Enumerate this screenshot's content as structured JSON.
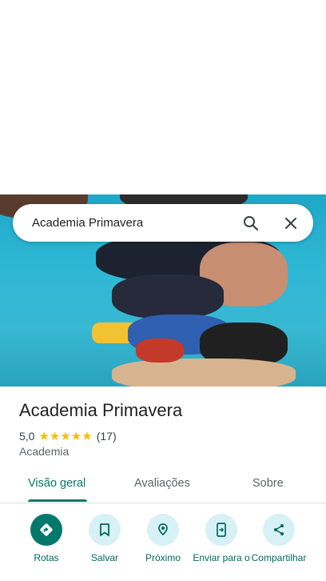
{
  "search": {
    "query": "Academia Primavera"
  },
  "place": {
    "name": "Academia Primavera",
    "rating": "5,0",
    "stars": "★★★★★",
    "review_count": "(17)",
    "category": "Academia"
  },
  "tabs": [
    {
      "label": "Visão geral",
      "active": true
    },
    {
      "label": "Avaliações",
      "active": false
    },
    {
      "label": "Sobre",
      "active": false
    }
  ],
  "actions": [
    {
      "label": "Rotas",
      "icon": "directions-icon"
    },
    {
      "label": "Salvar",
      "icon": "bookmark-icon"
    },
    {
      "label": "Próximo",
      "icon": "nearby-icon"
    },
    {
      "label": "Enviar para o",
      "icon": "send-to-phone-icon"
    },
    {
      "label": "Compartilhar",
      "icon": "share-icon"
    }
  ],
  "colors": {
    "accent": "#00796b",
    "action_bg": "#d7f1f6",
    "star": "#fbbc04"
  }
}
